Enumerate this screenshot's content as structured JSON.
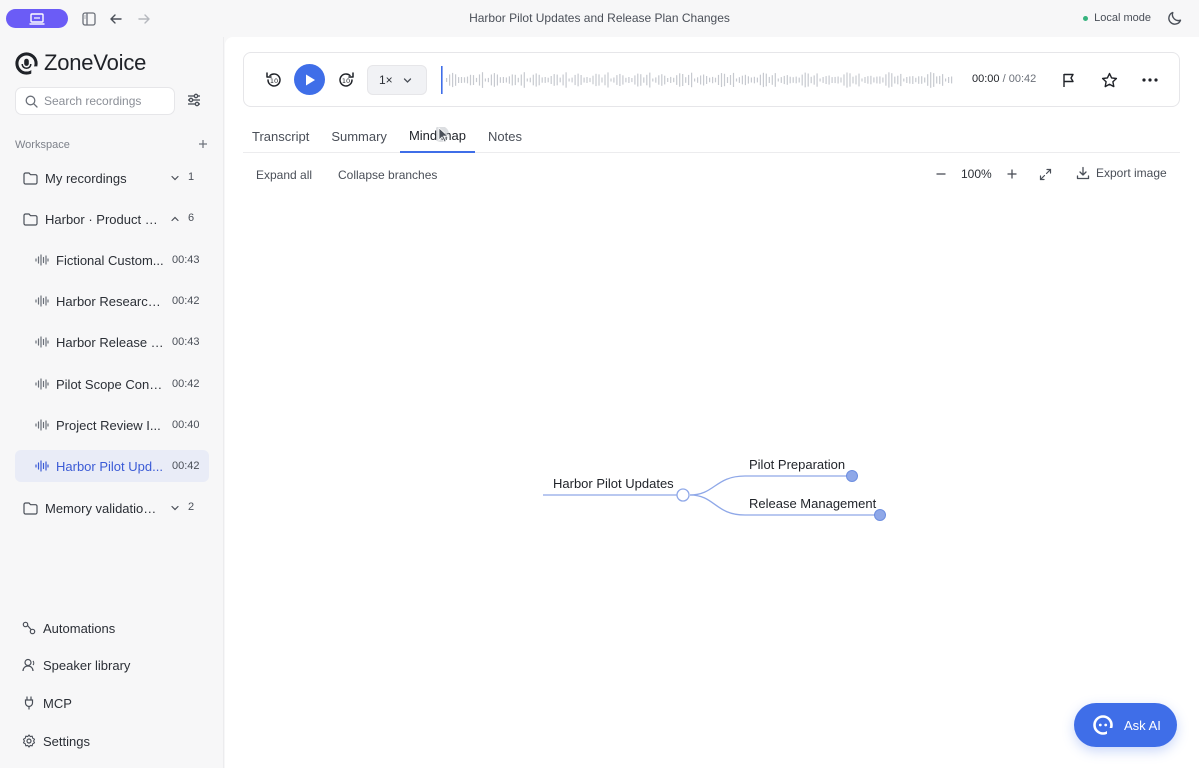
{
  "window": {
    "title": "Harbor Pilot Updates and Release Plan Changes",
    "mode": "Local mode"
  },
  "brand": {
    "name": "ZoneVoice"
  },
  "sidebar": {
    "search_placeholder": "Search recordings",
    "workspace_label": "Workspace",
    "folders": [
      {
        "label": "My recordings",
        "count": "1",
        "expanded": false
      },
      {
        "label": "Harbor · Product c...",
        "count": "6",
        "expanded": true
      },
      {
        "label": "Memory validation ...",
        "count": "2",
        "expanded": false
      }
    ],
    "recordings": [
      {
        "label": "Fictional Custom...",
        "duration": "00:43"
      },
      {
        "label": "Harbor Research ...",
        "duration": "00:42"
      },
      {
        "label": "Harbor Release P...",
        "duration": "00:43"
      },
      {
        "label": "Pilot Scope Confi...",
        "duration": "00:42"
      },
      {
        "label": "Project Review I...",
        "duration": "00:40"
      },
      {
        "label": "Harbor Pilot Upd...",
        "duration": "00:42",
        "active": true
      }
    ],
    "bottom": [
      {
        "label": "Automations",
        "icon": "automation-icon"
      },
      {
        "label": "Speaker library",
        "icon": "speaker-icon"
      },
      {
        "label": "MCP",
        "icon": "plug-icon"
      },
      {
        "label": "Settings",
        "icon": "gear-icon"
      }
    ]
  },
  "player": {
    "speed": "1×",
    "current_time": "00:00",
    "separator": " / ",
    "total_time": "00:42",
    "progress": 0
  },
  "tabs": [
    {
      "label": "Transcript"
    },
    {
      "label": "Summary"
    },
    {
      "label": "Mind map",
      "active": true
    },
    {
      "label": "Notes"
    }
  ],
  "mindmap_toolbar": {
    "expand_all": "Expand all",
    "collapse_branches": "Collapse branches",
    "zoom": "100%",
    "export": "Export image"
  },
  "mindmap": {
    "root": "Harbor Pilot Updates",
    "children": [
      "Pilot Preparation",
      "Release Management"
    ]
  },
  "ask_ai": {
    "label": "Ask AI"
  },
  "colors": {
    "accent": "#3f6ee8",
    "brand_pill": "#6b5cf6",
    "status_dot": "#36b37e"
  }
}
